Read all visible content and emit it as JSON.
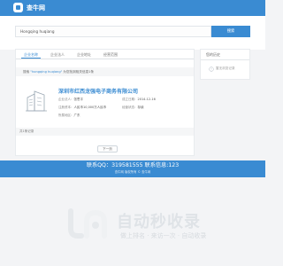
{
  "brand": {
    "name": "查牛网"
  },
  "search": {
    "value": "Hongqing huqiang",
    "button_label": "搜索"
  },
  "tabs": [
    {
      "label": "企业名称",
      "active": true
    },
    {
      "label": "企业法人",
      "active": false
    },
    {
      "label": "企业地址",
      "active": false
    },
    {
      "label": "经营范围",
      "active": false
    }
  ],
  "results": {
    "prefix": "搜索",
    "keyword": "\"hongqing huqiang\"",
    "suffix": "为您找到相关信息1条"
  },
  "company": {
    "name": "深圳市红西龙强电子商务有限公司",
    "legal_label": "企业法人：",
    "legal_value": "张思平",
    "date_label": "成立日期：",
    "date_value": "2014-12-16",
    "capital_label": "注册资本：",
    "capital_value": "人民币10,000万人民币",
    "status_label": "经营状态：",
    "status_value": "存续",
    "region_label": "所属地区：",
    "region_value": "广东"
  },
  "card_footer": "共1条记录",
  "pager": {
    "next_label": "下一页"
  },
  "history": {
    "title": "您的历史",
    "empty_text": "暂无浏览记录"
  },
  "footer": {
    "contact": "联系QQ：319581555 联系信息:123",
    "copyright": "查牛网 版权所有 © 查牛网"
  },
  "watermark": {
    "title": "自动秒收录",
    "subtitle": "做上排名 · 来访一次 · 自动收录"
  },
  "colors": {
    "primary": "#3a8bd2",
    "background": "#f3f4f6"
  }
}
